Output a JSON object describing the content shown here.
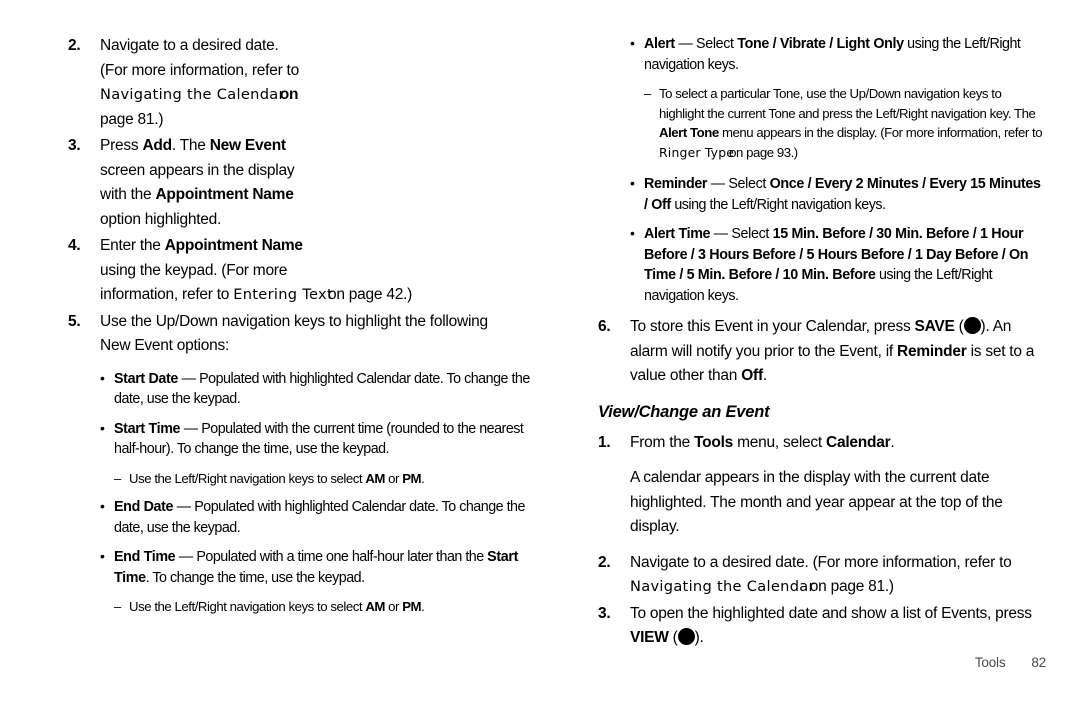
{
  "document": {
    "footer": {
      "section": "Tools",
      "page_number": "82"
    }
  },
  "left_column": {
    "steps": [
      {
        "number": "2.",
        "lines": {
          "l1": "Navigate to a desired date.",
          "l2": "(For more information, refer to",
          "xref": "Navigating the Calendar",
          "xref_tail": "on",
          "l4": "page 81.)"
        }
      },
      {
        "number": "3.",
        "lines": {
          "t1": "Press ",
          "b1": "Add",
          "t2": ". The ",
          "b2": "New Event",
          "t3": "screen appears in the display",
          "t4": "with the ",
          "b3": "Appointment Name",
          "t5": "option highlighted."
        }
      },
      {
        "number": "4.",
        "lines": {
          "t1": "Enter the ",
          "b1": "Appointment Name",
          "t2": "using the keypad. (For more",
          "t3": "information, refer to ",
          "xref": "Entering Text",
          "xref_tail": "on page 42.)"
        }
      },
      {
        "number": "5.",
        "lines": {
          "t1": "Use the Up/Down navigation keys to highlight the following",
          "t2": "New Event options:"
        }
      }
    ],
    "bullets": [
      {
        "term": "Start Date",
        "dash": "—",
        "text": " Populated with highlighted Calendar date. To change the date, use the keypad."
      },
      {
        "term": "Start Time",
        "dash": "—",
        "text": " Populated with the current time (rounded to the nearest half-hour). To change the time, use the keypad."
      },
      {
        "term": "End Date",
        "dash": "—",
        "text": " Populated with highlighted Calendar date. To change the date, use the keypad."
      },
      {
        "term": "End Time",
        "dash": "—",
        "text_a": " Populated with a time one half-hour later than the ",
        "term_b": "Start Time",
        "text_b": ". To change the time, use the keypad."
      }
    ],
    "sub_items": {
      "am_pm_1": {
        "pre": "Use the Left/Right navigation keys to select ",
        "am": "AM",
        "mid": " or ",
        "pm": "PM",
        "post": "."
      },
      "am_pm_2": {
        "pre": "Use the Left/Right navigation keys to select ",
        "am": "AM",
        "mid": " or ",
        "pm": "PM",
        "post": "."
      }
    }
  },
  "right_column": {
    "alert_bullet": {
      "term": "Alert",
      "dash": "—",
      "t1": " Select ",
      "opt1": "Tone",
      "sep1": " / ",
      "opt2": "Vibrate",
      "sep2": " / ",
      "opt3": "Light Only",
      "t2": " using the Left/Right navigation keys."
    },
    "alert_sub": {
      "t1": "To select a particular Tone, use the Up/Down navigation keys to highlight the current Tone and press the Left/Right navigation key. The ",
      "b1": "Alert Tone",
      "t2": " menu appears in the display. (For more information, refer to ",
      "xref": "Ringer Type",
      "xref_tail": "on page 93.)"
    },
    "reminder_bullet": {
      "term": "Reminder",
      "dash": "—",
      "t1": " Select ",
      "opt1": "Once",
      "sep1": " / ",
      "opt2": "Every 2 Minutes",
      "sep2": " / ",
      "opt3": "Every 15 Minutes",
      "sep3": " / ",
      "opt4": "Off",
      "t2": " using the Left/Right navigation keys."
    },
    "alert_time_bullet": {
      "term": "Alert Time",
      "dash": "—",
      "t1": " Select ",
      "options": [
        "15 Min. Before",
        "30 Min. Before",
        "1 Hour Before",
        "3 Hours Before",
        "5 Hours Before",
        "1 Day Before",
        "On Time",
        "5 Min. Before",
        "10 Min. Before"
      ],
      "separator": " / ",
      "t2": " using the Left/Right navigation keys."
    },
    "step6": {
      "number": "6.",
      "t1": "To store this Event in your Calendar, press ",
      "b1": "SAVE",
      "t2": " (",
      "icon": "save-key-circle",
      "t3": "). An alarm will notify you prior to the Event, if ",
      "b2": "Reminder",
      "t4": " is set to a value other than ",
      "b3": "Off",
      "t5": "."
    },
    "section_heading": "View/Change an Event",
    "steps": [
      {
        "number": "1.",
        "t1": "From the ",
        "b1": "Tools",
        "t2": " menu, select ",
        "b2": "Calendar",
        "t3": ".",
        "para": "A calendar appears in the display with the current date highlighted. The month and year appear at the top of the display."
      },
      {
        "number": "2.",
        "t1": "Navigate to a desired date. (For more information, refer to ",
        "xref": "Navigating the Calendar",
        "xref_tail": "on page 81.)"
      },
      {
        "number": "3.",
        "t1": "To open the highlighted date and show a list of Events, press ",
        "b1": "VIEW",
        "t2": " (",
        "icon": "view-key-circle",
        "t3": ")."
      }
    ]
  }
}
